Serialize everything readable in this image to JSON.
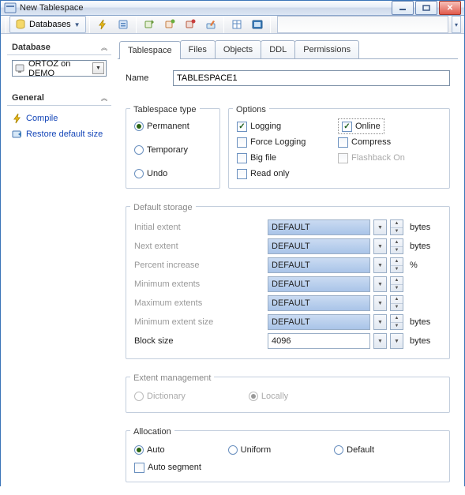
{
  "window": {
    "title": "New Tablespace"
  },
  "toolbar": {
    "databases_label": "Databases",
    "icons": [
      "lightning",
      "execute",
      "add",
      "add2",
      "remove",
      "edit",
      "table",
      "script",
      "compile"
    ]
  },
  "sidebar": {
    "database": {
      "header": "Database",
      "value": "ORTOZ on DEMO"
    },
    "general": {
      "header": "General",
      "links": {
        "compile": "Compile",
        "restore": "Restore default size"
      }
    }
  },
  "tabs": {
    "items": [
      "Tablespace",
      "Files",
      "Objects",
      "DDL",
      "Permissions"
    ],
    "active": 0
  },
  "form": {
    "name_label": "Name",
    "name_value": "TABLESPACE1",
    "tablespace_type": {
      "legend": "Tablespace type",
      "options": {
        "permanent": "Permanent",
        "temporary": "Temporary",
        "undo": "Undo"
      },
      "selected": "permanent"
    },
    "options": {
      "legend": "Options",
      "logging": "Logging",
      "force_logging": "Force Logging",
      "big_file": "Big file",
      "read_only": "Read only",
      "online": "Online",
      "compress": "Compress",
      "flashback_on": "Flashback On",
      "checked": [
        "logging",
        "online"
      ],
      "disabled": [
        "flashback_on"
      ],
      "highlight": "online"
    },
    "default_storage": {
      "legend": "Default storage",
      "rows": [
        {
          "label": "Initial extent",
          "value": "DEFAULT",
          "unit": "bytes",
          "enabled": false,
          "spinner": true
        },
        {
          "label": "Next extent",
          "value": "DEFAULT",
          "unit": "bytes",
          "enabled": false,
          "spinner": true
        },
        {
          "label": "Percent increase",
          "value": "DEFAULT",
          "unit": "%",
          "enabled": false,
          "spinner": true
        },
        {
          "label": "Minimum extents",
          "value": "DEFAULT",
          "unit": "",
          "enabled": false,
          "spinner": true
        },
        {
          "label": "Maximum extents",
          "value": "DEFAULT",
          "unit": "",
          "enabled": false,
          "spinner": true
        },
        {
          "label": "Minimum extent size",
          "value": "DEFAULT",
          "unit": "bytes",
          "enabled": false,
          "spinner": true
        },
        {
          "label": "Block size",
          "value": "4096",
          "unit": "bytes",
          "enabled": true,
          "spinner": false
        }
      ]
    },
    "extent_management": {
      "legend": "Extent management",
      "dictionary": "Dictionary",
      "locally": "Locally",
      "selected": "locally",
      "enabled": false
    },
    "allocation": {
      "legend": "Allocation",
      "auto": "Auto",
      "uniform": "Uniform",
      "default": "Default",
      "auto_segment": "Auto segment",
      "selected": "auto"
    }
  }
}
